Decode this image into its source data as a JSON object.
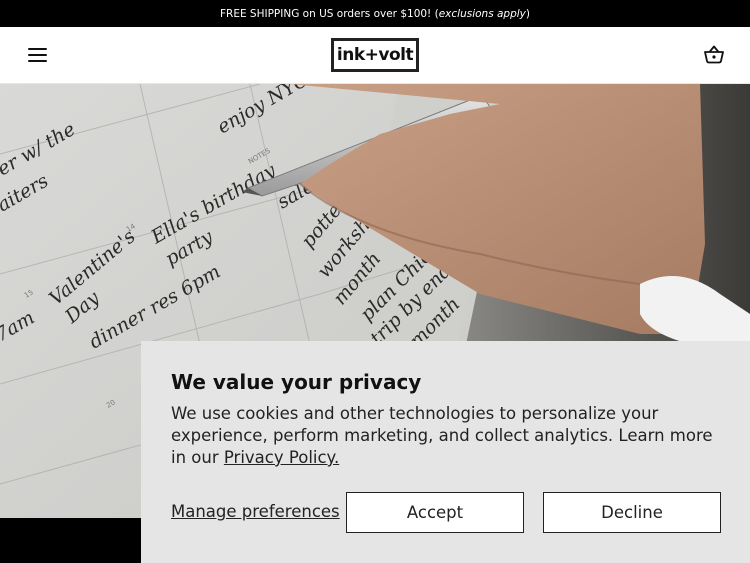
{
  "announcement": {
    "main": "FREE SHIPPING on US orders over $100! (",
    "emphasis": "exclusions apply",
    "close": ")"
  },
  "header": {
    "logo_text": "ink+volt",
    "menu_icon": "hamburger-menu-icon",
    "cart_icon": "shopping-basket-icon"
  },
  "hero": {
    "notes": [
      "enjoy NYC",
      "er w/ the",
      "aiters",
      "Ella's birthday",
      "party",
      "sale",
      "pottery",
      "workshop",
      "month",
      "Valentine's",
      "Day",
      "dinner res 6pm",
      "plan Chicago",
      "trip by end",
      "of month",
      "7am"
    ],
    "small_labels": [
      "NOTES",
      "14",
      "15",
      "20"
    ]
  },
  "cookie_banner": {
    "title": "We value your privacy",
    "body": "We use cookies and other technologies to personalize your experience, perform marketing, and collect analytics. Learn more in our ",
    "privacy_link": "Privacy Policy.",
    "manage_label": "Manage preferences",
    "accept_label": "Accept",
    "decline_label": "Decline"
  }
}
